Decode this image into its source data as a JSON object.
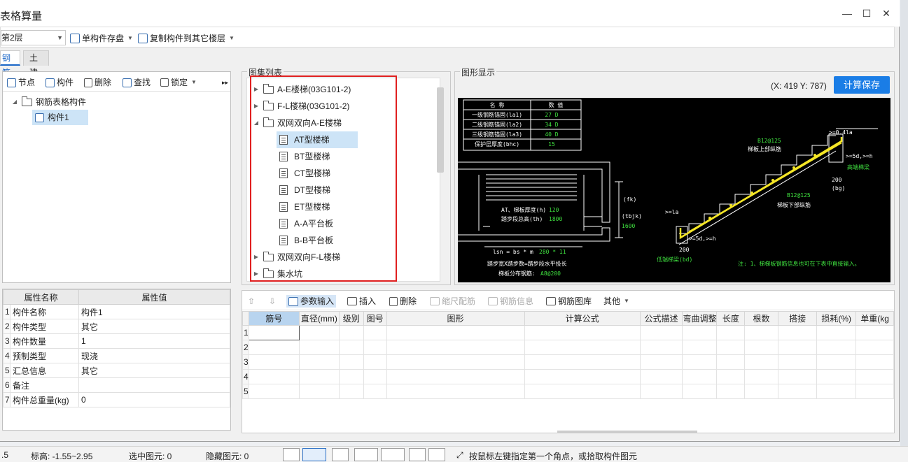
{
  "window": {
    "title": "表格算量",
    "minimize": "—",
    "maximize": "☐",
    "close": "✕"
  },
  "toolbar": {
    "floor": "第2层",
    "save_single": "单构件存盘",
    "copy_to_floor": "复制构件到其它楼层"
  },
  "tabs": [
    {
      "label": "钢筋"
    },
    {
      "label": "土建"
    }
  ],
  "left_toolbar": {
    "node": "节点",
    "component": "构件",
    "delete": "删除",
    "find": "查找",
    "lock": "锁定",
    "more": "▸▸"
  },
  "left_tree": {
    "root": "钢筋表格构件",
    "child": "构件1"
  },
  "properties": {
    "headers": [
      "属性名称",
      "属性值"
    ],
    "rows": [
      {
        "idx": "1",
        "name": "构件名称",
        "value": "构件1"
      },
      {
        "idx": "2",
        "name": "构件类型",
        "value": "其它"
      },
      {
        "idx": "3",
        "name": "构件数量",
        "value": "1"
      },
      {
        "idx": "4",
        "name": "预制类型",
        "value": "现浇"
      },
      {
        "idx": "5",
        "name": "汇总信息",
        "value": "其它"
      },
      {
        "idx": "6",
        "name": "备注",
        "value": ""
      },
      {
        "idx": "7",
        "name": "构件总重量(kg)",
        "value": "0"
      }
    ]
  },
  "atlas": {
    "label": "图集列表",
    "folders_top": [
      "A-E楼梯(03G101-2)",
      "F-L楼梯(03G101-2)"
    ],
    "open_folder": "双网双向A-E楼梯",
    "items": [
      "AT型楼梯",
      "BT型楼梯",
      "CT型楼梯",
      "DT型楼梯",
      "ET型楼梯",
      "A-A平台板",
      "B-B平台板"
    ],
    "folders_bottom": [
      "双网双向F-L楼梯",
      "集水坑"
    ]
  },
  "shape": {
    "label": "图形显示",
    "coord": "(X: 419 Y: 787)",
    "calc_save": "计算保存",
    "drawing": {
      "table_headers": [
        "名  称",
        "数  值"
      ],
      "table_rows": [
        {
          "name": "一级钢筋锚固(la1)",
          "value": "27 D"
        },
        {
          "name": "二级钢筋锚固(la2)",
          "value": "34 D"
        },
        {
          "name": "三级钢筋锚固(la3)",
          "value": "40 D"
        },
        {
          "name": "保护层厚度(bhc)",
          "value": "15"
        }
      ],
      "note_plate": "AT、梯板厚度(h)",
      "plate_h": "120",
      "note_height": "踏步段总高(th)",
      "th": "1800",
      "lsn": "lsn = bs * m",
      "lsn_val": "280 * 11",
      "step_desc": "踏步宽X踏步数=踏步段水平投长",
      "dist": "梯板分布钢筋:",
      "dist_val": "A8@200",
      "fk": "(fk)",
      "tbjk": "(tbjk)",
      "v1600": "1600",
      "b12_top": "B12@125",
      "top_rebar": "梯板上部纵筋",
      "b12_bot": "B12@125",
      "bot_rebar": "梯板下部纵筋",
      "high_beam": "高端梯梁",
      "low_beam": "低端梯梁(bd)",
      "v200a": "200",
      "v200b": "200",
      "bg": "(bg)",
      "d04": ">=0.4la",
      "d5": ">=5d,>=h",
      "d5b": ">=5d,>=h",
      "la": ">=la",
      "note": "注: 1、梯梯板钢筋信息也可在下表中直接输入。"
    }
  },
  "grid_toolbar": {
    "param_input": "参数输入",
    "insert": "插入",
    "delete": "删除",
    "scale_rebar": "缩尺配筋",
    "rebar_info": "钢筋信息",
    "rebar_lib": "钢筋图库",
    "other": "其他"
  },
  "grid": {
    "headers": [
      "筋号",
      "直径(mm)",
      "级别",
      "图号",
      "图形",
      "计算公式",
      "公式描述",
      "弯曲调整",
      "长度",
      "根数",
      "搭接",
      "损耗(%)",
      "单重(kg"
    ],
    "row_numbers": [
      "1",
      "2",
      "3",
      "4",
      "5"
    ]
  },
  "status": {
    "left": ".5",
    "elevation": "标高:  -1.55~2.95",
    "selected": "选中图元:  0",
    "hidden": "隐藏图元:  0",
    "hint": "按鼠标左键指定第一个角点，或拾取构件图元"
  }
}
